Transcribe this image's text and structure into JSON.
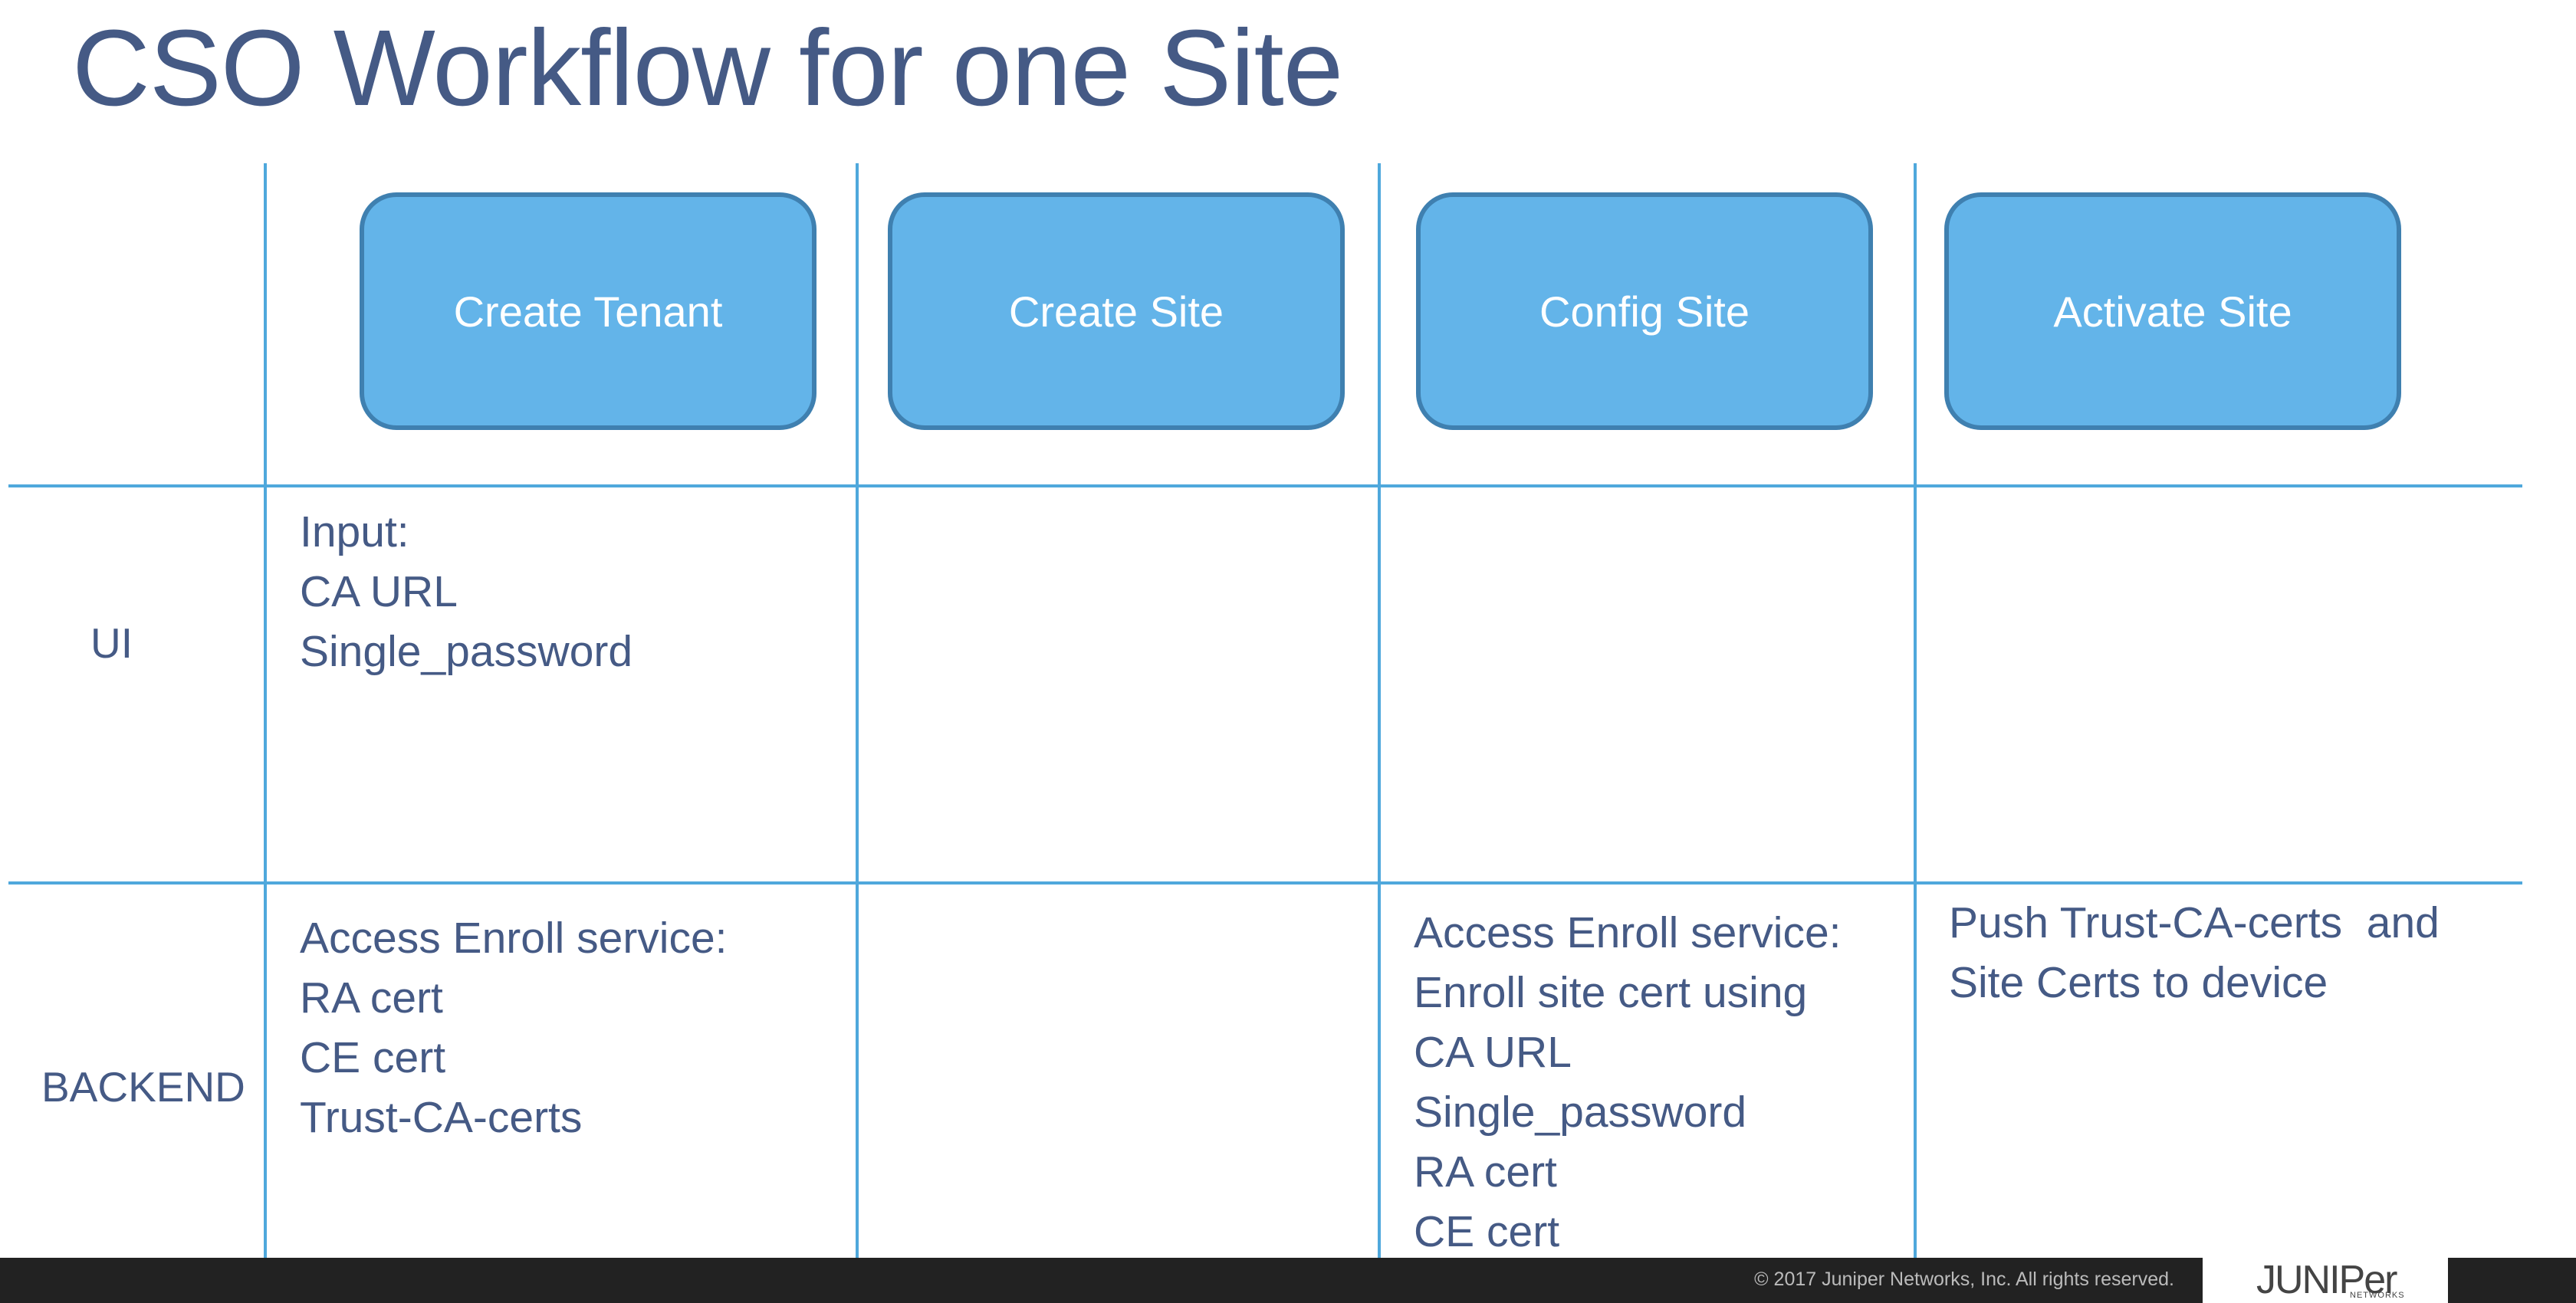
{
  "title": "CSO Workflow for one Site",
  "steps": [
    "Create Tenant",
    "Create Site",
    "Config Site",
    "Activate Site"
  ],
  "rows": {
    "ui_label": "UI",
    "backend_label": "BACKEND"
  },
  "ui_cells": {
    "create_tenant": [
      "Input:",
      "CA URL",
      "Single_password"
    ]
  },
  "backend_cells": {
    "create_tenant": [
      "Access Enroll service:",
      "RA cert",
      "CE cert",
      "Trust-CA-certs"
    ],
    "config_site": [
      "Access Enroll service:",
      "Enroll site cert using",
      "CA URL",
      "Single_password",
      "RA cert",
      "CE cert"
    ],
    "activate_site": [
      "Push Trust-CA-certs  and",
      "Site Certs to device"
    ]
  },
  "footer": {
    "copyright": "© 2017 Juniper Networks, Inc. All rights reserved.",
    "logo": "JUNIPer",
    "logo_sub": "NETWORKS"
  },
  "colors": {
    "title": "#455a85",
    "box_fill": "#63b4e9",
    "box_border": "#3f80b0",
    "grid_lines": "#4fa8dc",
    "footer_bar": "#222222"
  }
}
